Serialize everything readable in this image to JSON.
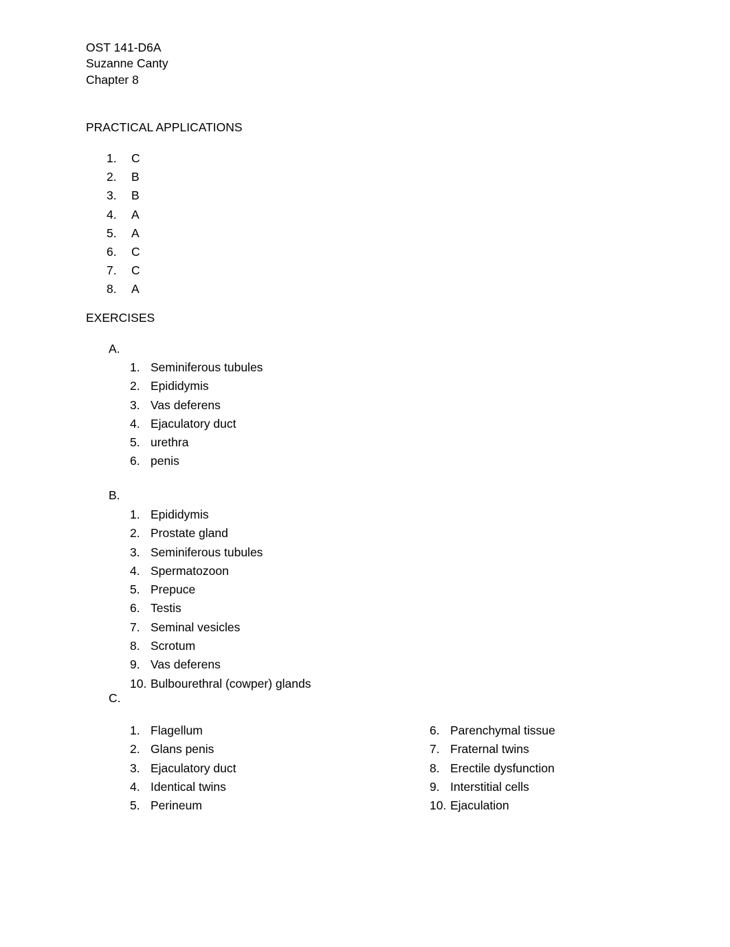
{
  "document": {
    "header_lines": [
      "OST 141-D6A",
      "Suzanne Canty",
      "Chapter 8"
    ],
    "practical_applications": {
      "heading": "PRACTICAL APPLICATIONS",
      "items": [
        {
          "num": "1.",
          "value": "C"
        },
        {
          "num": "2.",
          "value": "B"
        },
        {
          "num": "3.",
          "value": "B"
        },
        {
          "num": "4.",
          "value": "A"
        },
        {
          "num": "5.",
          "value": "A"
        },
        {
          "num": "6.",
          "value": "C"
        },
        {
          "num": "7.",
          "value": "C"
        },
        {
          "num": "8.",
          "value": "A"
        }
      ]
    },
    "exercises": {
      "heading": "EXERCISES",
      "section_a": {
        "letter": "A.",
        "items": [
          {
            "num": "1.",
            "text": "Seminiferous tubules"
          },
          {
            "num": "2.",
            "text": "Epididymis"
          },
          {
            "num": "3.",
            "text": "Vas deferens"
          },
          {
            "num": "4.",
            "text": "Ejaculatory duct"
          },
          {
            "num": "5.",
            "text": "urethra"
          },
          {
            "num": "6.",
            "text": "penis"
          }
        ]
      },
      "section_b": {
        "letter": "B.",
        "items": [
          {
            "num": "1.",
            "text": "Epididymis"
          },
          {
            "num": "2.",
            "text": "Prostate gland"
          },
          {
            "num": "3.",
            "text": "Seminiferous tubules"
          },
          {
            "num": "4.",
            "text": "Spermatozoon"
          },
          {
            "num": "5.",
            "text": "Prepuce"
          },
          {
            "num": "6.",
            "text": "Testis"
          },
          {
            "num": "7.",
            "text": "Seminal vesicles"
          },
          {
            "num": "8.",
            "text": "Scrotum"
          },
          {
            "num": "9.",
            "text": "Vas deferens"
          },
          {
            "num": "10.",
            "text": "Bulbourethral (cowper) glands"
          }
        ]
      },
      "section_c": {
        "letter": "C.",
        "column_left": [
          {
            "num": "1.",
            "text": "Flagellum"
          },
          {
            "num": "2.",
            "text": "Glans penis"
          },
          {
            "num": "3.",
            "text": "Ejaculatory duct"
          },
          {
            "num": "4.",
            "text": "Identical twins"
          },
          {
            "num": "5.",
            "text": "Perineum"
          }
        ],
        "column_right": [
          {
            "num": "6.",
            "text": "Parenchymal tissue"
          },
          {
            "num": "7.",
            "text": "Fraternal twins"
          },
          {
            "num": "8.",
            "text": "Erectile dysfunction"
          },
          {
            "num": "9.",
            "text": "Interstitial cells"
          },
          {
            "num": "10.",
            "text": "Ejaculation"
          }
        ]
      }
    }
  }
}
